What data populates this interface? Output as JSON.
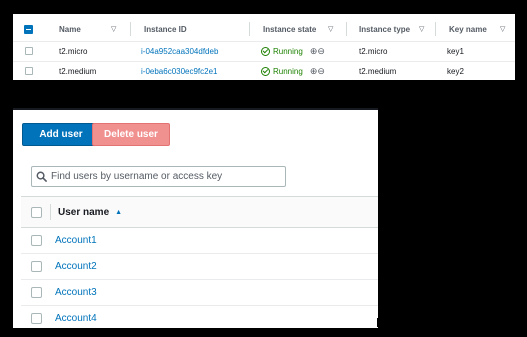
{
  "instances": {
    "columns": {
      "name": "Name",
      "instance_id": "Instance ID",
      "instance_state": "Instance state",
      "instance_type": "Instance type",
      "key_name": "Key name"
    },
    "rows": [
      {
        "name": "t2.micro",
        "instance_id": "i-04a952caa304dfdeb",
        "state": "Running",
        "type": "t2.micro",
        "key": "key1"
      },
      {
        "name": "t2.medium",
        "instance_id": "i-0eba6c030ec9fc2e1",
        "state": "Running",
        "type": "t2.medium",
        "key": "key2"
      }
    ],
    "zoom_glyphs": "⊕⊖"
  },
  "users": {
    "add_label": "Add user",
    "delete_label": "Delete user",
    "search_placeholder": "Find users by username or access key",
    "column_username": "User name",
    "rows": [
      "Account1",
      "Account2",
      "Account3",
      "Account4"
    ]
  },
  "colors": {
    "link": "#0073bb",
    "running": "#1d8102",
    "delete_disabled": "#f0908f"
  }
}
